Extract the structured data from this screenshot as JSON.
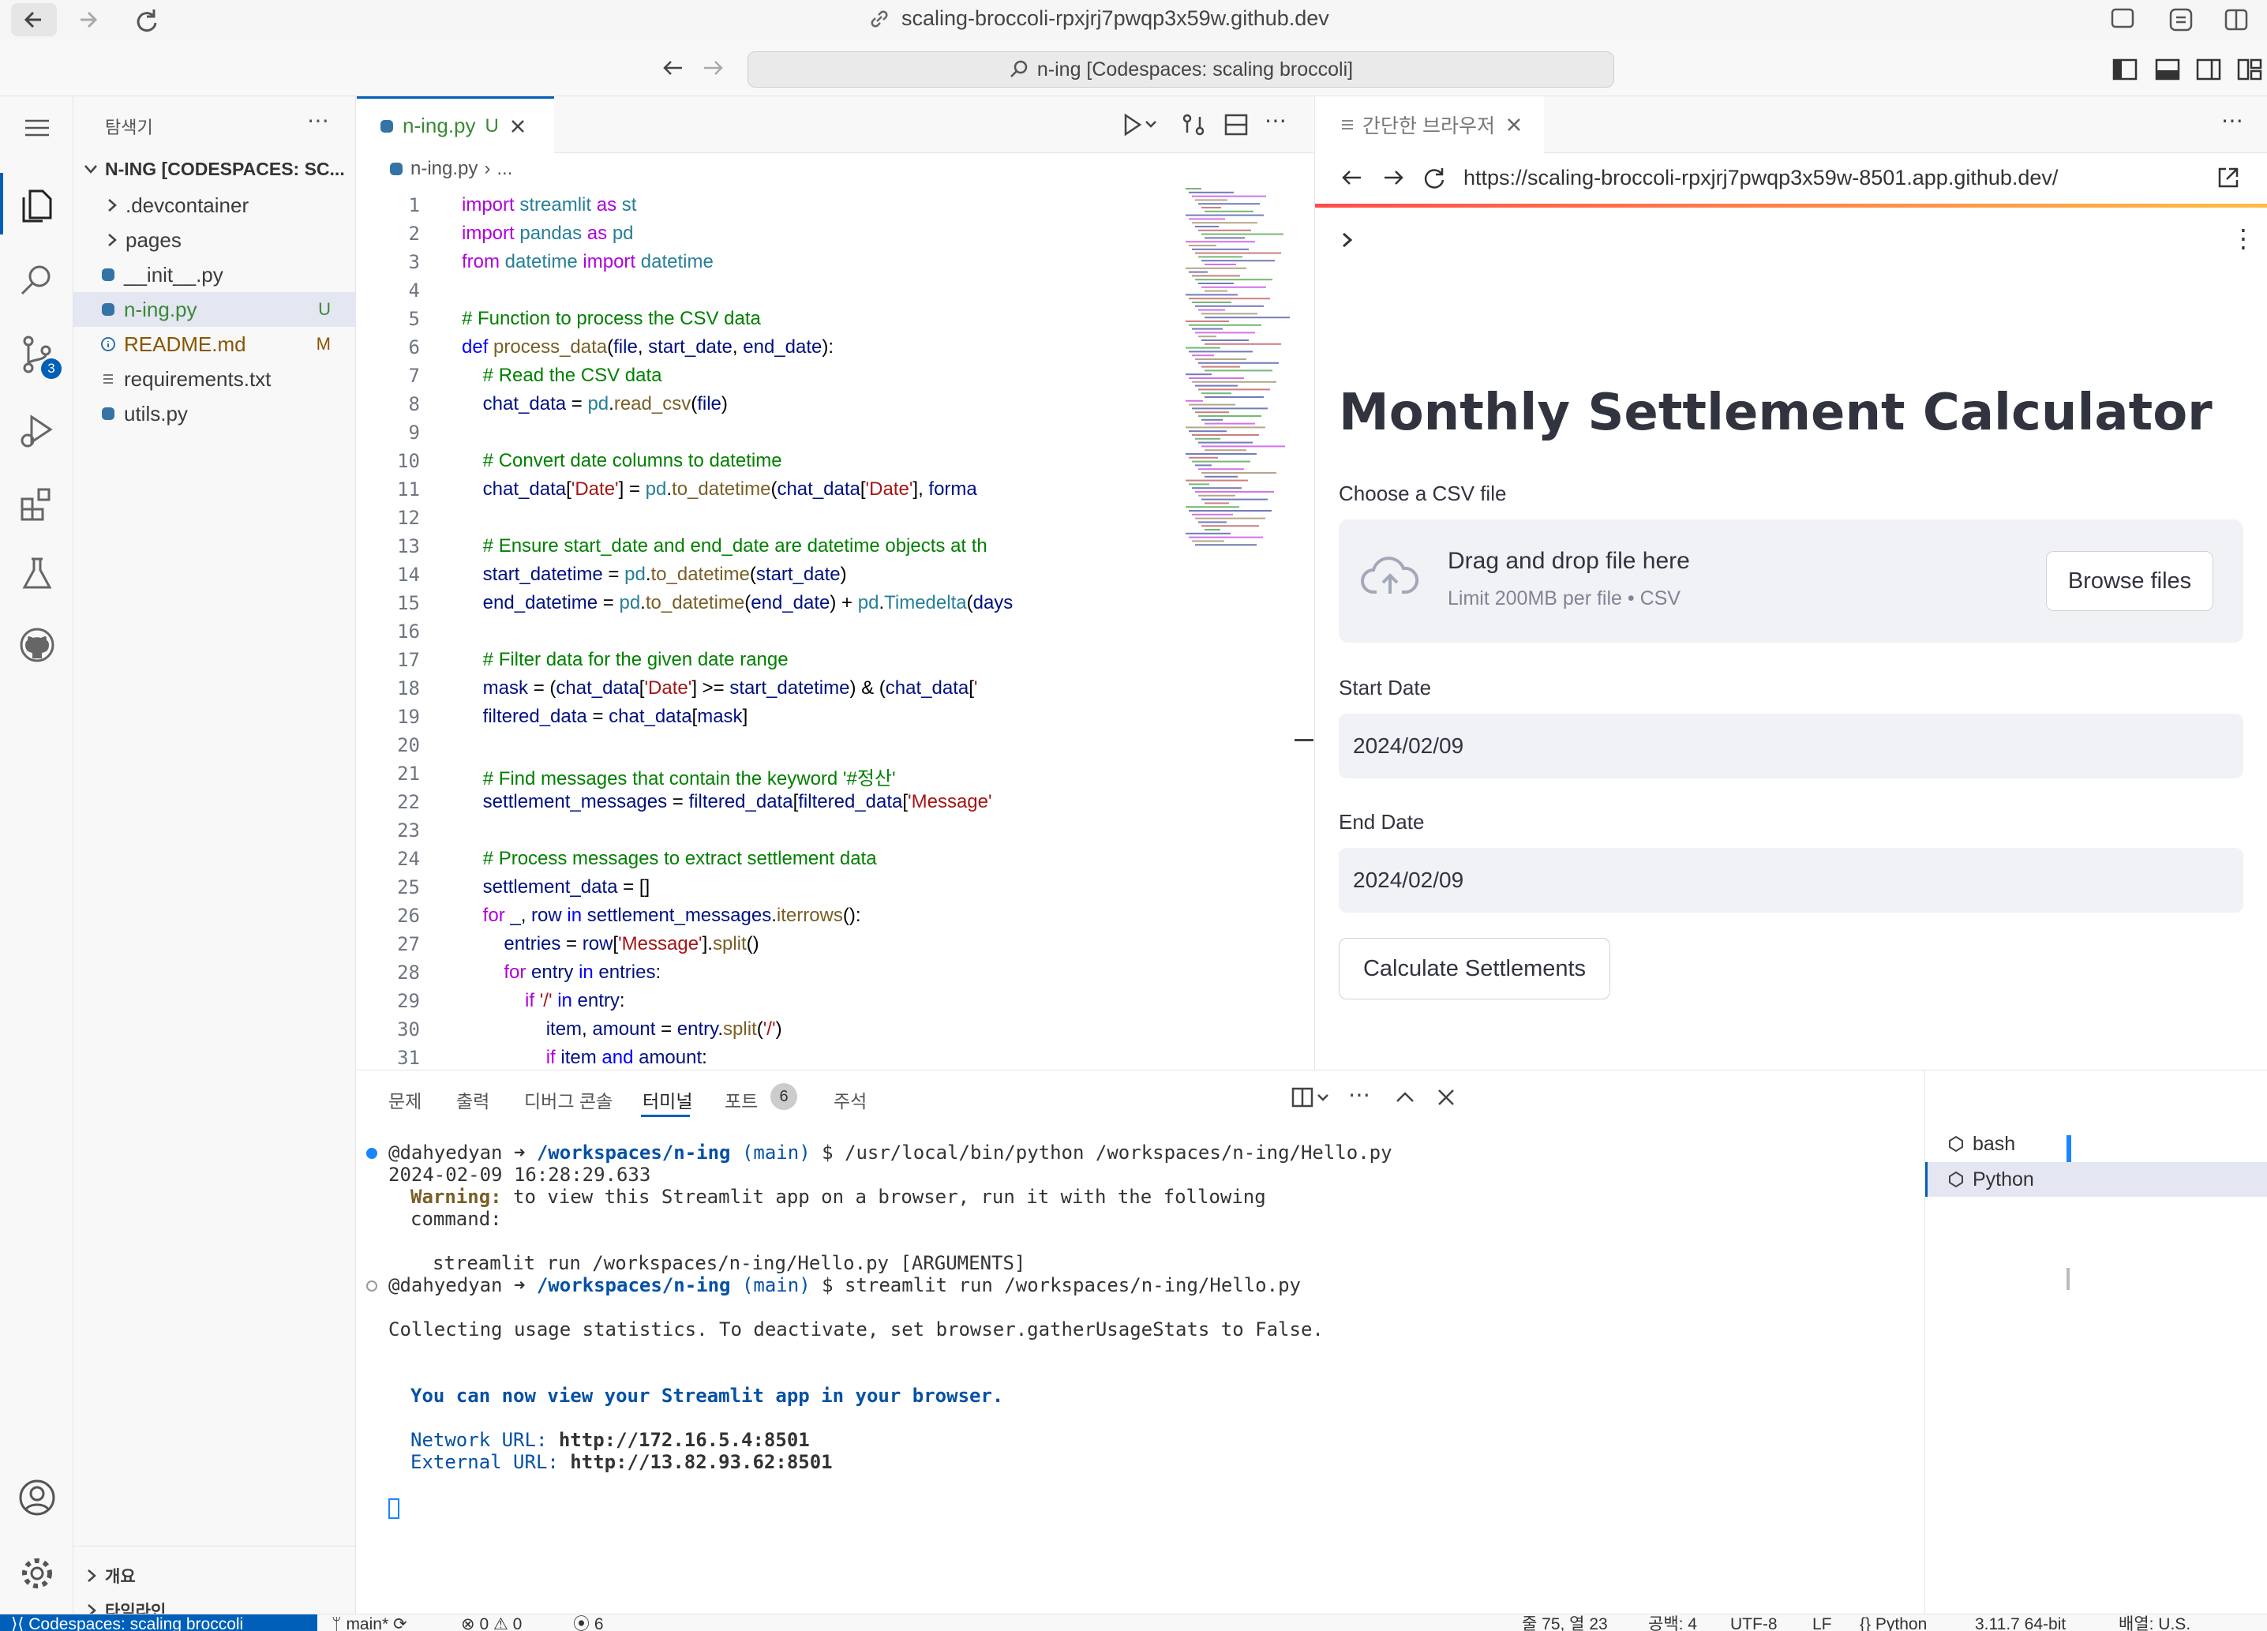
{
  "browser": {
    "url_title": "scaling-broccoli-rpxjrj7pwqp3x59w.github.dev"
  },
  "titlebar": {
    "command_center": "n-ing [Codespaces: scaling broccoli]"
  },
  "activity": {
    "scm_badge": "3"
  },
  "sidebar": {
    "title": "탐색기",
    "root": "N-ING [CODESPACES: SC...",
    "items": [
      {
        "label": ".devcontainer",
        "badge": ""
      },
      {
        "label": "pages",
        "badge": ""
      },
      {
        "label": "__init__.py",
        "badge": ""
      },
      {
        "label": "n-ing.py",
        "badge": "U"
      },
      {
        "label": "README.md",
        "badge": "M"
      },
      {
        "label": "requirements.txt",
        "badge": ""
      },
      {
        "label": "utils.py",
        "badge": ""
      }
    ],
    "outline": "개요",
    "timeline": "타임라인"
  },
  "editor": {
    "tab_label": "n-ing.py",
    "tab_badge": "U",
    "breadcrumb_file": "n-ing.py",
    "breadcrumb_more": "...",
    "lines": [
      "1",
      "2",
      "3",
      "4",
      "5",
      "6",
      "7",
      "8",
      "9",
      "10",
      "11",
      "12",
      "13",
      "14",
      "15",
      "16",
      "17",
      "18",
      "19",
      "20",
      "21",
      "22",
      "23",
      "24",
      "25",
      "26",
      "27",
      "28",
      "29",
      "30",
      "31"
    ]
  },
  "simple_browser": {
    "tab_label": "간단한 브라우저",
    "url": "https://scaling-broccoli-rpxjrj7pwqp3x59w-8501.app.github.dev/",
    "app_title": "Monthly Settlement Calculator",
    "file_label": "Choose a CSV file",
    "drop_title": "Drag and drop file here",
    "drop_limit": "Limit 200MB per file • CSV",
    "browse_button": "Browse files",
    "start_label": "Start Date",
    "start_value": "2024/02/09",
    "end_label": "End Date",
    "end_value": "2024/02/09",
    "calc_button": "Calculate Settlements"
  },
  "panel": {
    "tabs": [
      {
        "label": "문제"
      },
      {
        "label": "출력"
      },
      {
        "label": "디버그 콘솔"
      },
      {
        "label": "터미널"
      },
      {
        "label": "포트"
      },
      {
        "label": "주석"
      }
    ],
    "ports_badge": "6",
    "terminals": [
      "bash",
      "Python"
    ],
    "term": {
      "user1": "@dahyedyan",
      "path1": "/workspaces/n-ing",
      "branch1": "(main)",
      "cmd1": "$ /usr/local/bin/python /workspaces/n-ing/Hello.py",
      "timestamp": "2024-02-09 16:28:29.633",
      "warning_label": "Warning:",
      "warning_text": "to view this Streamlit app on a browser, run it with the following",
      "warning_text2": "command:",
      "suggest": "streamlit run /workspaces/n-ing/Hello.py [ARGUMENTS]",
      "user2": "@dahyedyan",
      "path2": "/workspaces/n-ing",
      "branch2": "(main)",
      "cmd2": "$ streamlit run /workspaces/n-ing/Hello.py",
      "collecting": "Collecting usage statistics. To deactivate, set browser.gatherUsageStats to False.",
      "view_msg": "You can now view your Streamlit app in your browser.",
      "network_label": "Network URL:",
      "network_url": "http://172.16.5.4:8501",
      "external_label": "External URL:",
      "external_url": "http://13.82.93.62:8501"
    }
  },
  "status": {
    "remote": "Codespaces: scaling broccoli",
    "branch": "main*",
    "errors": "0",
    "warnings": "0",
    "ports": "6",
    "position": "줄 75, 열 23",
    "spaces": "공백: 4",
    "encoding": "UTF-8",
    "eol": "LF",
    "language": "Python",
    "interpreter": "3.11.7 64-bit",
    "layout": "배열: U.S."
  },
  "colors": {
    "accent": "#005fb8",
    "modified": "#895503",
    "untracked": "#388a34",
    "remote_bg": "#005fb8"
  }
}
